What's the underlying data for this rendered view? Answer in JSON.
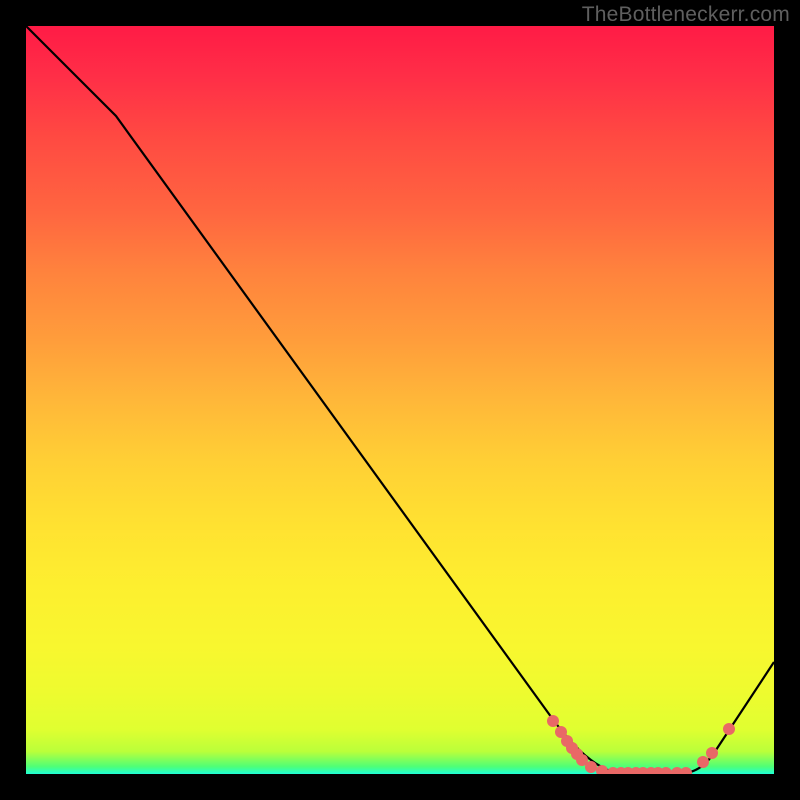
{
  "watermark": "TheBottleneckerr.com",
  "chart_data": {
    "type": "line",
    "title": "",
    "xlabel": "",
    "ylabel": "",
    "xlim": [
      0,
      100
    ],
    "ylim": [
      0,
      100
    ],
    "series": [
      {
        "name": "bottleneck-curve",
        "x": [
          0,
          7,
          12,
          70,
          79,
          88,
          92,
          100
        ],
        "y": [
          100,
          93,
          88,
          8,
          0,
          0,
          3,
          15
        ],
        "color": "#000000"
      }
    ],
    "markers": {
      "name": "highlight-dots",
      "color": "#e96866",
      "points": [
        {
          "x": 70.5,
          "y": 7.0
        },
        {
          "x": 71.5,
          "y": 5.5
        },
        {
          "x": 72.3,
          "y": 4.3
        },
        {
          "x": 73.0,
          "y": 3.5
        },
        {
          "x": 73.6,
          "y": 2.7
        },
        {
          "x": 74.3,
          "y": 1.9
        },
        {
          "x": 75.5,
          "y": 0.9
        },
        {
          "x": 77.0,
          "y": 0.3
        },
        {
          "x": 78.5,
          "y": 0.0
        },
        {
          "x": 79.5,
          "y": 0.0
        },
        {
          "x": 80.5,
          "y": 0.0
        },
        {
          "x": 81.5,
          "y": 0.0
        },
        {
          "x": 82.5,
          "y": 0.0
        },
        {
          "x": 83.5,
          "y": 0.0
        },
        {
          "x": 84.5,
          "y": 0.0
        },
        {
          "x": 85.5,
          "y": 0.0
        },
        {
          "x": 87.0,
          "y": 0.0
        },
        {
          "x": 88.3,
          "y": 0.0
        },
        {
          "x": 90.5,
          "y": 1.5
        },
        {
          "x": 91.7,
          "y": 2.7
        },
        {
          "x": 94.0,
          "y": 5.8
        }
      ]
    },
    "gradient_colors": {
      "top": "#ff1b46",
      "mid": "#ffe231",
      "bottom": "#1fffd5"
    }
  }
}
